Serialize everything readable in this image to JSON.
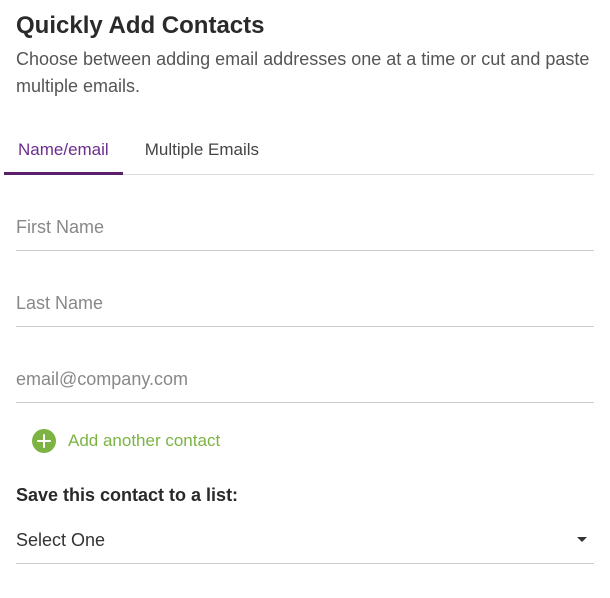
{
  "header": {
    "title": "Quickly Add Contacts",
    "description": "Choose between adding email addresses one at a time or cut and paste multiple emails."
  },
  "tabs": {
    "nameEmail": "Name/email",
    "multipleEmails": "Multiple Emails"
  },
  "fields": {
    "firstNamePlaceholder": "First Name",
    "lastNamePlaceholder": "Last Name",
    "emailPlaceholder": "email@company.com"
  },
  "addAnother": {
    "label": "Add another contact"
  },
  "saveToList": {
    "label": "Save this contact to a list:",
    "selected": "Select One"
  },
  "colors": {
    "accent": "#6b2d8e",
    "green": "#7cb342"
  }
}
